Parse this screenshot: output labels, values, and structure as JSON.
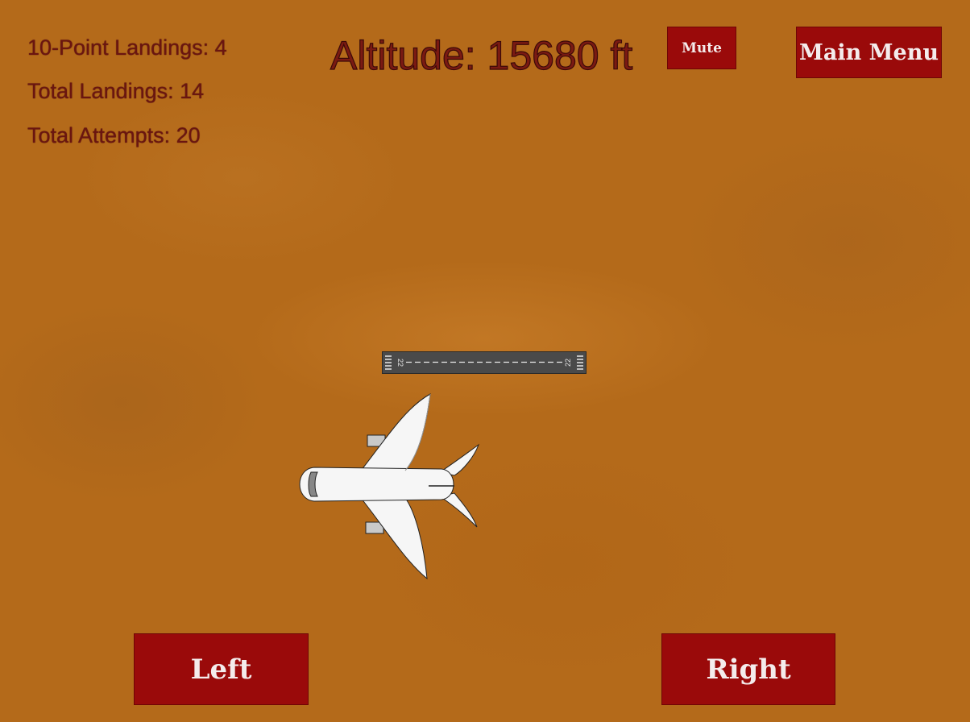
{
  "stats": {
    "ten_point_landings": "10-Point Landings: 4",
    "total_landings": "Total Landings: 14",
    "total_attempts": "Total Attempts: 20"
  },
  "altitude": "Altitude: 15680 ft",
  "buttons": {
    "mute": "Mute",
    "main_menu": "Main Menu",
    "left": "Left",
    "right": "Right"
  },
  "runway": {
    "number_left": "22",
    "number_right": "22"
  },
  "colors": {
    "background": "#b46a1a",
    "button": "#9a0a0a",
    "text": "#6b1510"
  }
}
